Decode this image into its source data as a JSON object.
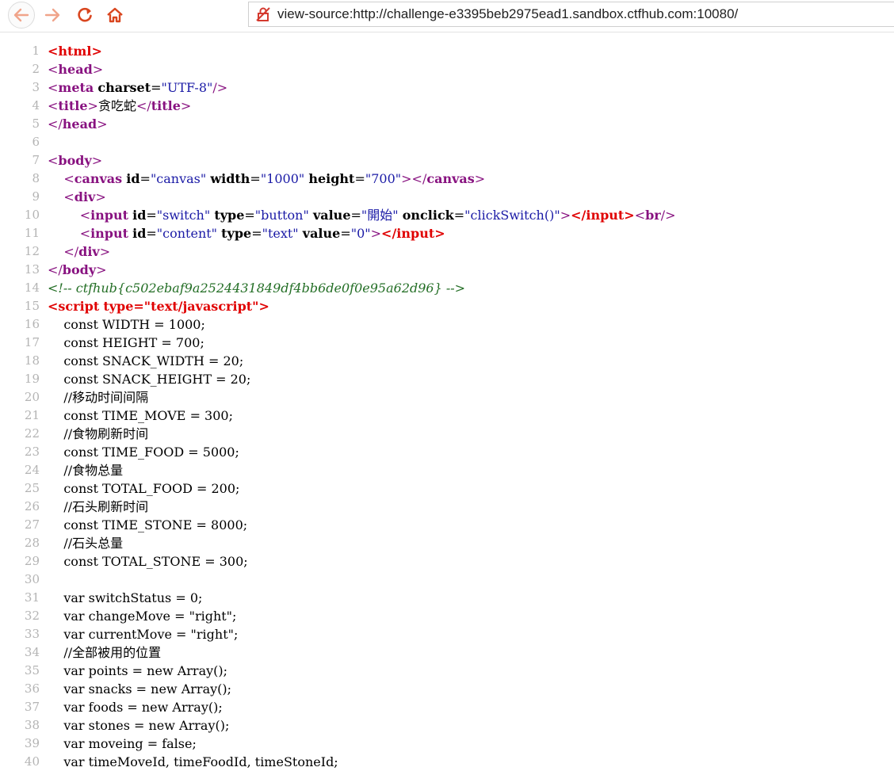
{
  "browser": {
    "url": "view-source:http://challenge-e3395beb2975ead1.sandbox.ctfhub.com:10080/",
    "back_icon": "arrow-left-icon",
    "forward_icon": "arrow-right-icon",
    "reload_icon": "reload-icon",
    "home_icon": "home-icon",
    "security_icon": "insecure-lock-icon"
  },
  "colors": {
    "tag": "#881280",
    "red_tag": "#e00000",
    "attr_value": "#1a1aa6",
    "comment": "#236e25",
    "line_number": "#b4b4b4"
  },
  "source": {
    "title_text": "贪吃蛇",
    "charset": "UTF-8",
    "canvas_attrs": {
      "id": "canvas",
      "width": "1000",
      "height": "700"
    },
    "switch_input": {
      "id": "switch",
      "type": "button",
      "value": "開始",
      "onclick": "clickSwitch()"
    },
    "content_input": {
      "id": "content",
      "type": "text",
      "value": "0"
    },
    "comment": "<!-- ctfhub{c502ebaf9a2524431849df4bb6de0f0e95a62d96} -->",
    "script_type": "text/javascript",
    "js_lines": [
      "    const WIDTH = 1000;",
      "    const HEIGHT = 700;",
      "    const SNACK_WIDTH = 20;",
      "    const SNACK_HEIGHT = 20;",
      "    //移动时间间隔",
      "    const TIME_MOVE = 300;",
      "    //食物刷新时间",
      "    const TIME_FOOD = 5000;",
      "    //食物总量",
      "    const TOTAL_FOOD = 200;",
      "    //石头刷新时间",
      "    const TIME_STONE = 8000;",
      "    //石头总量",
      "    const TOTAL_STONE = 300;",
      "",
      "    var switchStatus = 0;",
      "    var changeMove = \"right\";",
      "    var currentMove = \"right\";",
      "    //全部被用的位置",
      "    var points = new Array();",
      "    var snacks = new Array();",
      "    var foods = new Array();",
      "    var stones = new Array();",
      "    var moveing = false;",
      "    var timeMoveId, timeFoodId, timeStoneId;"
    ]
  }
}
